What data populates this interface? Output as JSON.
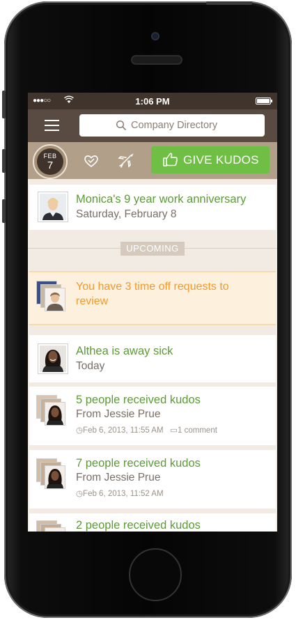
{
  "status_bar": {
    "signal": "●●●○○",
    "time": "1:06 PM"
  },
  "nav": {
    "search_placeholder": "Company Directory"
  },
  "action_bar": {
    "date_month": "FEB",
    "date_day": "7",
    "give_kudos_label": "GIVE KUDOS"
  },
  "feed": {
    "anniversary": {
      "title": "Monica's 9 year work anniversary",
      "subtitle": "Saturday, February 8"
    },
    "upcoming_label": "UPCOMING",
    "time_off": {
      "text": "You have 3 time off requests to review"
    },
    "sick": {
      "title": "Althea is away sick",
      "subtitle": "Today"
    },
    "kudos": [
      {
        "title": "5 people received kudos",
        "from": "From Jessie Prue",
        "timestamp": "Feb 6, 2013, 11:55 AM",
        "comments": "1 comment"
      },
      {
        "title": "7 people received kudos",
        "from": "From Jessie Prue",
        "timestamp": "Feb 6, 2013, 11:52 AM"
      },
      {
        "title": "2 people received kudos"
      }
    ]
  },
  "colors": {
    "accent_green": "#6fbf44",
    "nav_brown": "#5a4b42",
    "alert_orange": "#f29a2c",
    "title_green": "#5c9a37"
  },
  "icons": [
    "search-icon",
    "heart-icon",
    "airplane-icon",
    "thumbs-up-icon",
    "clock-icon",
    "comment-icon",
    "wifi-icon",
    "battery-icon"
  ]
}
